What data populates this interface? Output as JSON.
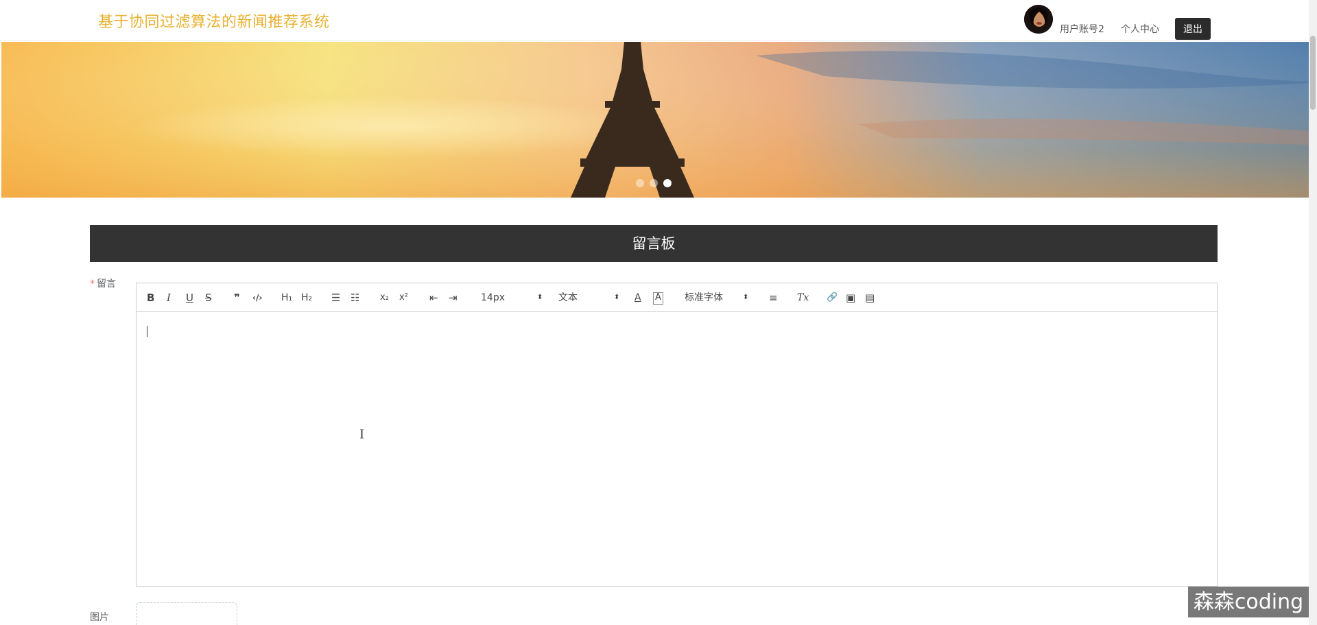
{
  "header": {
    "site_title": "基于协同过滤算法的新闻推荐系统",
    "user_name": "用户账号2",
    "personal_center": "个人中心",
    "logout_label": "退出"
  },
  "banner": {
    "slide_count": 3,
    "active_slide": 3
  },
  "board": {
    "title": "留言板"
  },
  "form": {
    "message_required_mark": "*",
    "message_label": "留言",
    "image_label": "图片"
  },
  "editor": {
    "toolbar": {
      "bold": "B",
      "italic": "I",
      "underline": "U",
      "strike": "S",
      "blockquote": "❞",
      "code": "‹/›",
      "h1": "H₁",
      "h2": "H₂",
      "ordered_list": "☰",
      "bullet_list": "☷",
      "subscript": "x₂",
      "superscript": "x²",
      "outdent": "⇤",
      "indent": "⇥",
      "font_size": "14px",
      "header_select": "文本",
      "font_color": "A",
      "background_color": "A",
      "font_family": "标准字体",
      "align": "≡",
      "clean": "Tx",
      "link": "🔗",
      "image": "▣",
      "video": "▤"
    },
    "content": ""
  },
  "watermark": {
    "text": "森森coding"
  }
}
